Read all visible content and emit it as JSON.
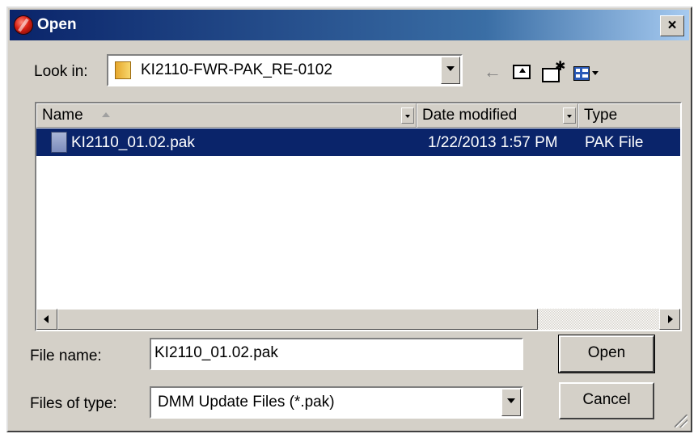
{
  "window": {
    "title": "Open",
    "close_glyph": "×"
  },
  "lookin": {
    "label": "Look in:",
    "value": "KI2110-FWR-PAK_RE-0102",
    "icon": "folder-icon"
  },
  "toolbar": {
    "back_glyph": "←",
    "icons": [
      "back-arrow-icon",
      "up-folder-icon",
      "new-folder-icon",
      "view-menu-icon"
    ]
  },
  "list": {
    "columns": [
      {
        "label": "Name",
        "sort": "ascending"
      },
      {
        "label": "Date modified"
      },
      {
        "label": "Type"
      }
    ],
    "rows": [
      {
        "name": "KI2110_01.02.pak",
        "date_modified": "1/22/2013 1:57 PM",
        "type": "PAK File",
        "selected": true
      }
    ]
  },
  "filename": {
    "label": "File name:",
    "value": "KI2110_01.02.pak"
  },
  "filetype": {
    "label": "Files of type:",
    "value": "DMM Update Files (*.pak)"
  },
  "buttons": {
    "open": "Open",
    "cancel": "Cancel"
  },
  "colors": {
    "selection": "#0a246a",
    "face": "#d4d0c8",
    "title_start": "#0a246a",
    "title_end": "#a6caf0"
  }
}
